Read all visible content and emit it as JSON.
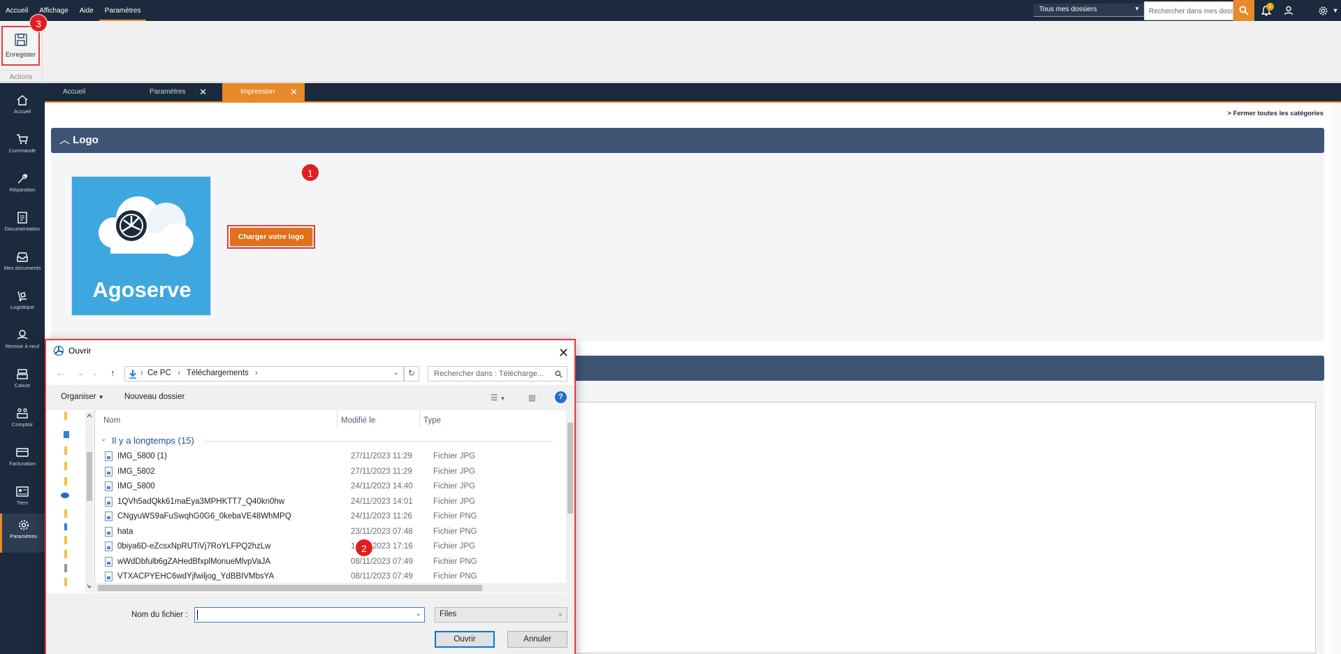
{
  "menu": [
    "Accueil",
    "Affichage",
    "Aide",
    "Paramètres"
  ],
  "topbar": {
    "folder_select": "Tous mes dossiers",
    "search_placeholder": "Rechercher dans mes dossiers",
    "notif_count": "1"
  },
  "ribbon": {
    "save_label": "Enregister",
    "group_label": "Actions"
  },
  "markers": [
    "1",
    "2",
    "3"
  ],
  "sidenav": [
    {
      "label": "Accueil",
      "icon": "home-icon"
    },
    {
      "label": "Commande",
      "icon": "cart-icon"
    },
    {
      "label": "Réparation",
      "icon": "wrench-icon"
    },
    {
      "label": "Documentation",
      "icon": "document-icon"
    },
    {
      "label": "Mes documents",
      "icon": "inbox-icon"
    },
    {
      "label": "Logistique",
      "icon": "dolly-icon"
    },
    {
      "label": "Remise à neuf",
      "icon": "refurbish-icon"
    },
    {
      "label": "Caisse",
      "icon": "register-icon"
    },
    {
      "label": "Comptoir",
      "icon": "counter-icon"
    },
    {
      "label": "Facturation",
      "icon": "card-icon"
    },
    {
      "label": "Tiers",
      "icon": "contact-card-icon"
    },
    {
      "label": "Paramètres",
      "icon": "gear-icon"
    }
  ],
  "tabs": [
    {
      "label": "Accueil",
      "closable": false
    },
    {
      "label": "Paramètres",
      "closable": true
    },
    {
      "label": "Impression",
      "closable": true,
      "active": true
    }
  ],
  "content": {
    "close_all": "Fermer toutes les catégories",
    "logo_section_title": "Logo",
    "logo_text": "Agoserve",
    "upload_button": "Charger votre logo"
  },
  "dialog": {
    "title": "Ouvrir",
    "path": [
      "Ce PC",
      "Téléchargements"
    ],
    "search_placeholder": "Rechercher dans : Télécharge...",
    "organize": "Organiser",
    "new_folder": "Nouveau dossier",
    "columns": [
      "Nom",
      "Modifié le",
      "Type"
    ],
    "group": "Il y a longtemps (15)",
    "files": [
      {
        "name": "IMG_5800 (1)",
        "date": "27/11/2023 11:29",
        "type": "Fichier JPG"
      },
      {
        "name": "IMG_5802",
        "date": "27/11/2023 11:29",
        "type": "Fichier JPG"
      },
      {
        "name": "IMG_5800",
        "date": "24/11/2023 14:40",
        "type": "Fichier JPG"
      },
      {
        "name": "1QVh5adQkk61maEya3MPHKTT7_Q40kn0hw",
        "date": "24/11/2023 14:01",
        "type": "Fichier JPG"
      },
      {
        "name": "CNgyuWS9aFuSwqhG0G6_0kebaVE48WhMPQ",
        "date": "24/11/2023 11:26",
        "type": "Fichier PNG"
      },
      {
        "name": "hata",
        "date": "23/11/2023 07:48",
        "type": "Fichier PNG"
      },
      {
        "name": "0biya6D-eZcsxNpRUTiVj7RoYLFPQ2hzLw",
        "date": "10/11/2023 17:16",
        "type": "Fichier JPG"
      },
      {
        "name": "wWdDbfulb6gZAHedBfxplMonueMlvpVaJA",
        "date": "08/11/2023 07:49",
        "type": "Fichier PNG"
      },
      {
        "name": "VTXACPYEHC6wdYjfwiljog_YdBBIVMbsYA",
        "date": "08/11/2023 07:49",
        "type": "Fichier PNG"
      }
    ],
    "filename_label": "Nom du fichier :",
    "filename_value": "",
    "filetype": "Files",
    "open_button": "Ouvrir",
    "cancel_button": "Annuler"
  },
  "colors": {
    "nav_bg": "#1b2a3d",
    "accent": "#e8892a",
    "section_header": "#3d5475",
    "highlight": "#e43b3b"
  }
}
